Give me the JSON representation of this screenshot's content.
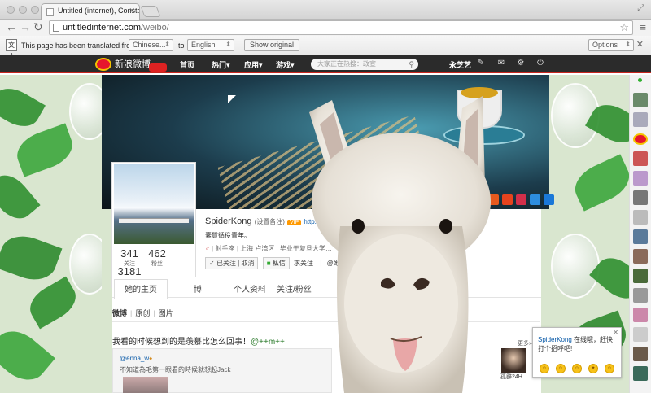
{
  "browser": {
    "tab_title": "Untitled (internet), Consta",
    "url_host": "untitledinternet.com",
    "url_path": "/weibo/"
  },
  "translate_bar": {
    "message": "This page has been translated from",
    "from_lang": "Chinese...",
    "to_word": "to",
    "to_lang": "English",
    "show_original": "Show original",
    "options": "Options"
  },
  "weibo_nav": {
    "logo_text": "新浪微博",
    "items": [
      "首页",
      "热门",
      "应用",
      "游戏"
    ],
    "search_placeholder": "大家正在热搜：政宣",
    "username": "永芝艺"
  },
  "profile": {
    "name": "SpiderKong",
    "remark": "(设置备注)",
    "vip": "VIP",
    "url": "http://weibo.c",
    "bio": "素質循役青年。",
    "meta_icon": "♂",
    "meta": [
      "射手座",
      "上海 卢湾区",
      "毕业于复旦大学…"
    ],
    "actions": [
      "已关注",
      "取消",
      "私信",
      "求关注",
      "@她"
    ],
    "stats": [
      {
        "num": "341",
        "label": "关注"
      },
      {
        "num": "462",
        "label": "粉丝"
      },
      {
        "num": "3181",
        "label": ""
      }
    ]
  },
  "profile_tabs": [
    "她的主页",
    "博",
    "个人资料",
    "关注/粉丝"
  ],
  "feed": {
    "filters": [
      "微博",
      "原创",
      "图片"
    ],
    "post_text": "我看的时候想到的是羡慕比怎么回事！",
    "post_hashtag": "@++m++",
    "repost_author": "@enna_w",
    "repost_text": "不知道為毛第一眼看的時候就想起Jack"
  },
  "sidebar": {
    "more": "更多»",
    "user_name": "孤辟24H"
  },
  "chat": {
    "name": "SpiderKong",
    "message": " 在线哦，赶快打个招呼吧!"
  },
  "colors": {
    "weibo_red": "#e6162d",
    "nav_bg": "#2b2b2b",
    "link_blue": "#0a5aa8"
  }
}
